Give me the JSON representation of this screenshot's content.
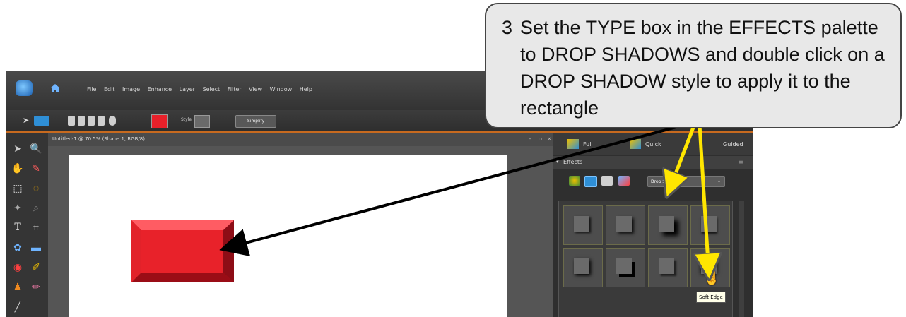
{
  "callout": {
    "step": "3",
    "text": "Set the TYPE box in the EFFECTS palette to DROP SHADOWS and double click on a DROP SHADOW style to apply it to the rectangle"
  },
  "menu": [
    "File",
    "Edit",
    "Image",
    "Enhance",
    "Layer",
    "Select",
    "Filter",
    "View",
    "Window",
    "Help"
  ],
  "toolbar": {
    "style_label": "Style",
    "simplify_label": "Simplify",
    "shape_color": "#e8202a"
  },
  "document": {
    "tab_title": "Untitled-1 @ 70.5% (Shape 1, RGB/8)"
  },
  "panel": {
    "modes": [
      "Full",
      "Quick",
      "Guided"
    ],
    "effects_title": "Effects",
    "type_value": "Drop Shadows"
  },
  "tooltip": "Soft Edge",
  "colors": {
    "accent_bar": "#c76a1f",
    "arrow_yellow": "#ffe600",
    "arrow_black": "#000000"
  }
}
